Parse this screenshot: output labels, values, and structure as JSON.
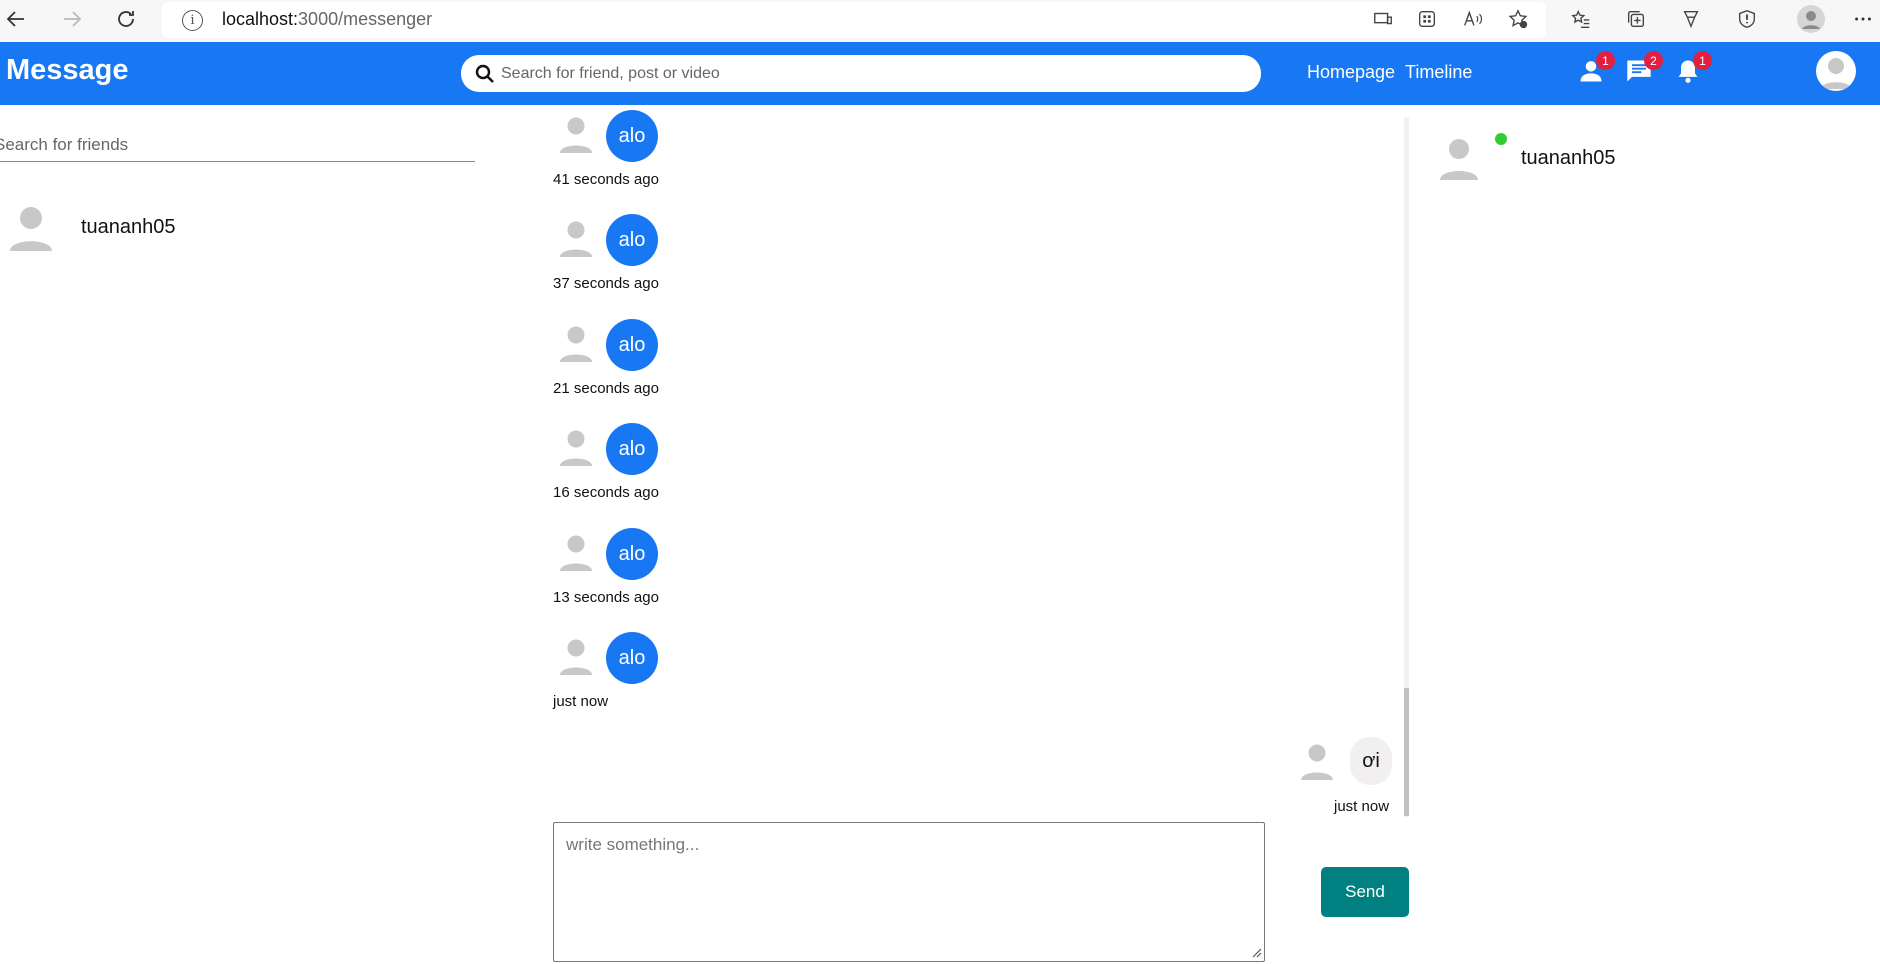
{
  "browser": {
    "url_host": "localhost:",
    "url_path": "3000/messenger",
    "info_glyph": "i"
  },
  "topbar": {
    "logo": "Message",
    "search_placeholder": "Search for friend, post or video",
    "links": [
      "Homepage",
      "Timeline"
    ],
    "badges": {
      "friends": "1",
      "messages": "2",
      "notifications": "1"
    },
    "accent_color": "#1877f2",
    "badge_color": "#e41e3f"
  },
  "menu": {
    "search_placeholder": "Search for friends",
    "conversations": [
      {
        "name": "tuananh05"
      }
    ]
  },
  "chat": {
    "messages": [
      {
        "text": "alo",
        "time": "41 seconds ago",
        "own": true
      },
      {
        "text": "alo",
        "time": "37 seconds ago",
        "own": true
      },
      {
        "text": "alo",
        "time": "21 seconds ago",
        "own": true
      },
      {
        "text": "alo",
        "time": "16 seconds ago",
        "own": true
      },
      {
        "text": "alo",
        "time": "13 seconds ago",
        "own": true
      },
      {
        "text": "alo",
        "time": "just now",
        "own": true
      },
      {
        "text": "ơi",
        "time": "just now",
        "own": false
      }
    ],
    "composer_placeholder": "write something...",
    "send_label": "Send",
    "send_color": "#008080"
  },
  "online": {
    "friends": [
      {
        "name": "tuananh05",
        "status_color": "#32cd32"
      }
    ]
  }
}
